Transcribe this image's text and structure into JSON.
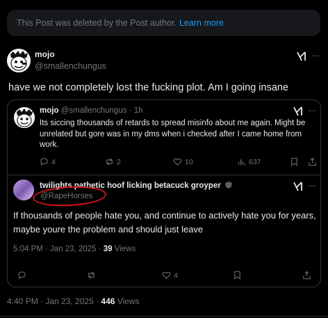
{
  "deleted_notice": {
    "text": "This Post was deleted by the Post author.",
    "link": "Learn more"
  },
  "main_post": {
    "author_name": "mojo",
    "author_handle": "@smallenchungus",
    "text": "have we not completely lost the fucking plot. Am I going insane"
  },
  "quote": {
    "author_name": "mojo",
    "author_handle": "@smallenchungus",
    "time": "1h",
    "text": "Its siccing thousands of retards to spread misinfo about me again. Might be unrelated but gore was in my dms when i checked after I came home from work.",
    "actions": {
      "replies": "4",
      "reposts": "2",
      "likes": "10",
      "views": "637"
    },
    "reply": {
      "author_name": "twilights pathetic hoof licking betacuck groyper",
      "author_handle": "@RapeHorses",
      "text": "If thousands of people hate you, and continue to actively hate you for years, maybe youre the problem and should just leave",
      "timestamp": "5:04 PM · Jan 23, 2025 ·",
      "views_count": "39",
      "views_label": "Views",
      "actions": {
        "likes": "4"
      }
    }
  },
  "main_meta": {
    "timestamp": "4:40 PM · Jan 23, 2025 ·",
    "views_count": "446",
    "views_label": "Views"
  },
  "colors": {
    "background": "#000000",
    "text": "#e7e9ea",
    "muted": "#71767b",
    "link": "#1d9bf0",
    "border": "#2f3336",
    "annotation": "#d8141e"
  },
  "icons": [
    "grok-icon",
    "more-icon",
    "reply-icon",
    "repost-icon",
    "like-icon",
    "views-icon",
    "bookmark-icon",
    "share-icon",
    "verified-shield-icon"
  ]
}
